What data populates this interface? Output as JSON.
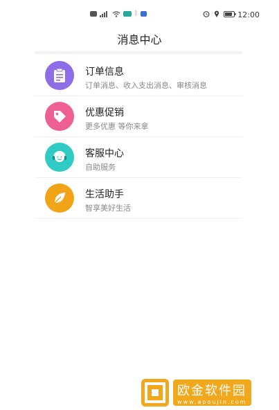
{
  "status_bar": {
    "time": "12:00",
    "icons": [
      "hd-icon",
      "signal-icon",
      "wifi-icon",
      "app-icon",
      "bluetooth-icon",
      "app-icon",
      "alarm-icon",
      "location-icon",
      "battery-icon"
    ]
  },
  "header": {
    "title": "消息中心"
  },
  "messages": [
    {
      "title": "订单信息",
      "subtitle": "订单消息、收入支出消息、审核消息",
      "icon": "clipboard-icon",
      "color": "#8e6ee6"
    },
    {
      "title": "优惠促销",
      "subtitle": "更多优惠  等你来拿",
      "icon": "tag-icon",
      "color": "#ee5f92"
    },
    {
      "title": "客服中心",
      "subtitle": "自助服务",
      "icon": "headset-icon",
      "color": "#2fcbc4"
    },
    {
      "title": "生活助手",
      "subtitle": "智享美好生活",
      "icon": "leaf-icon",
      "color": "#f2a419"
    }
  ],
  "watermark": {
    "text": "欧金软件园",
    "url": "www.apoujin.com"
  }
}
